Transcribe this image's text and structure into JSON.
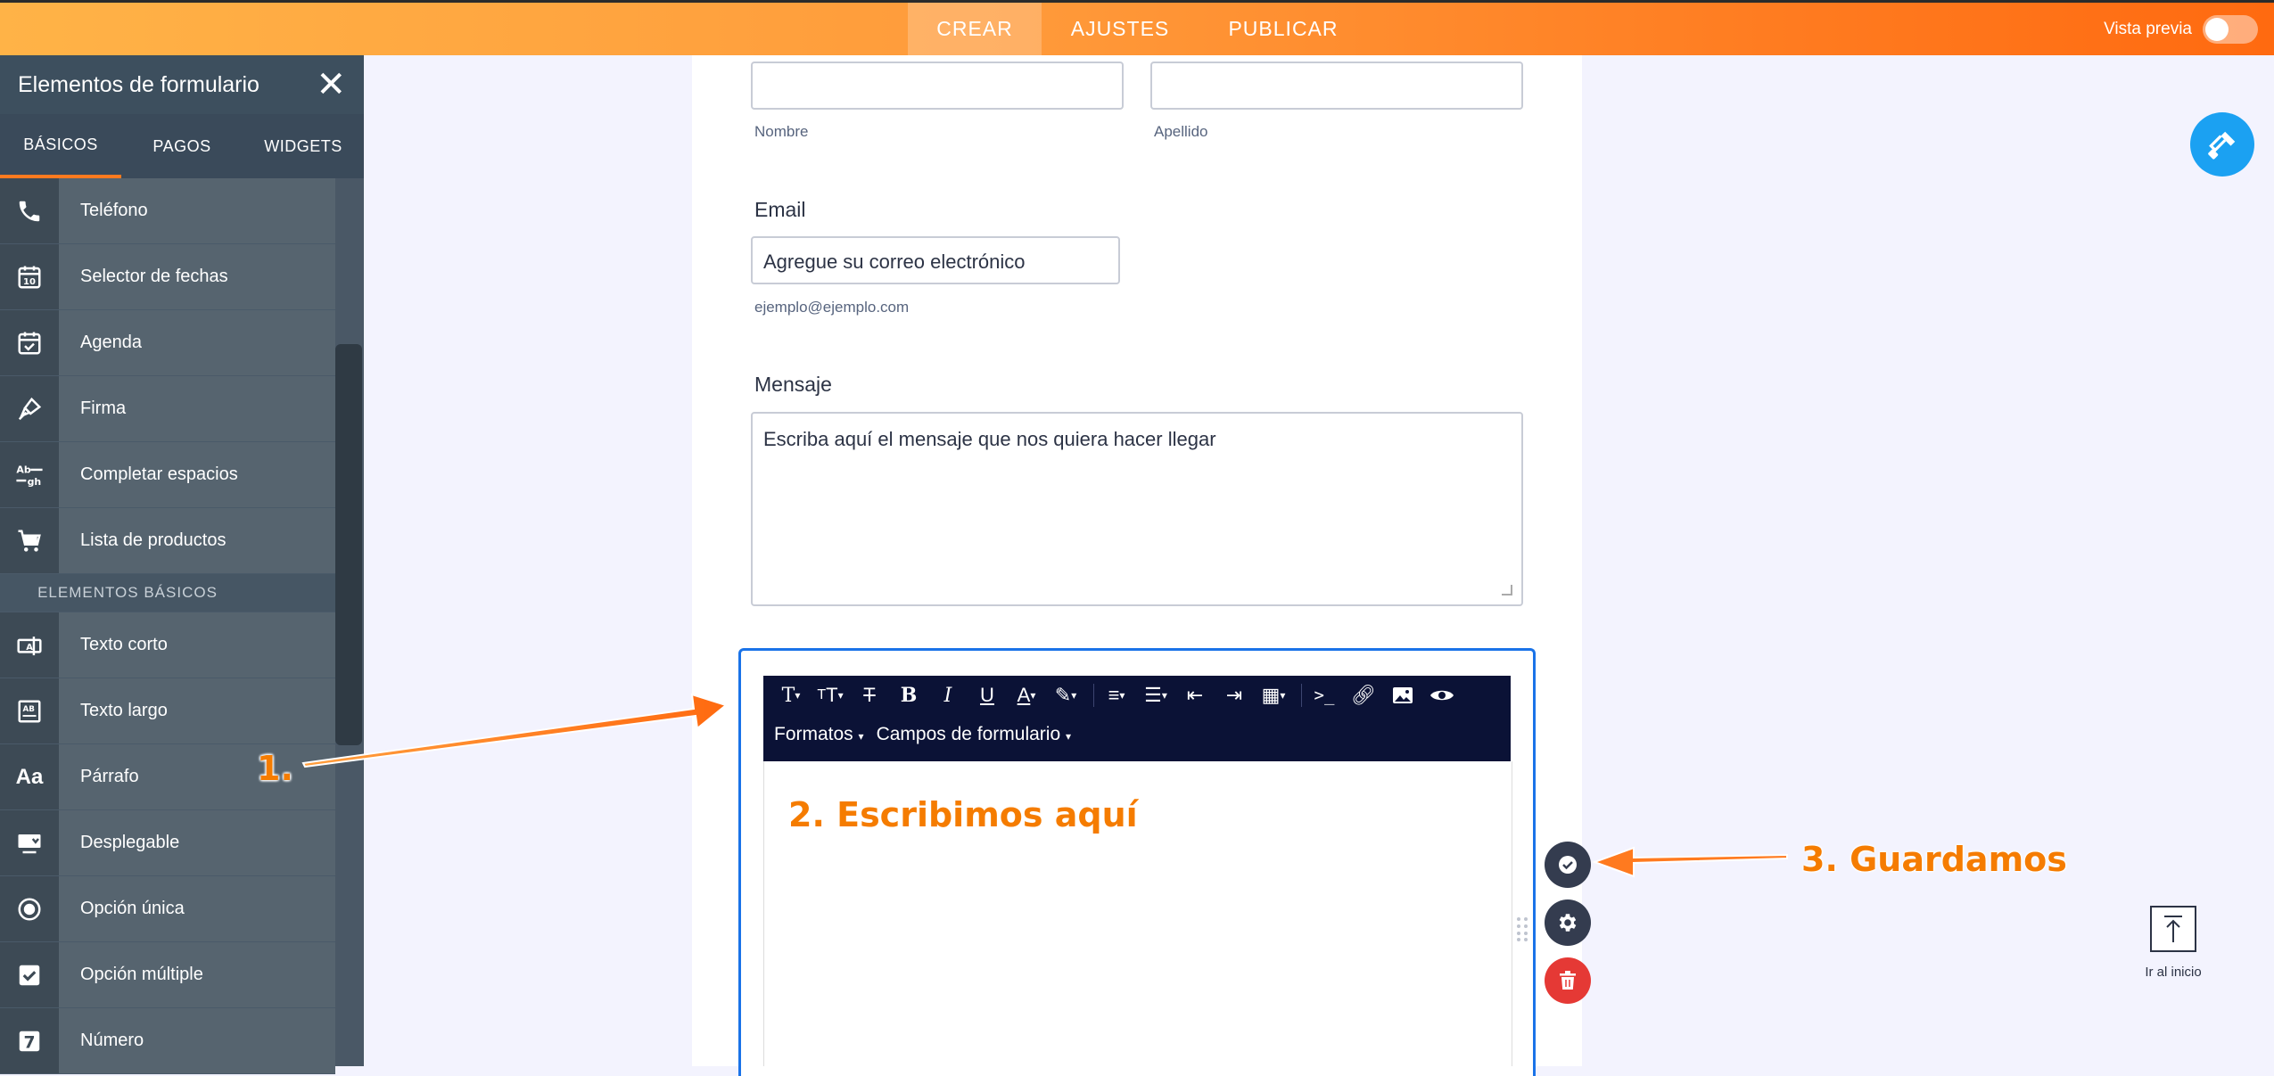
{
  "topbar": {
    "tabs": [
      "CREAR",
      "AJUSTES",
      "PUBLICAR"
    ],
    "preview_label": "Vista previa"
  },
  "sidebar": {
    "title": "Elementos de formulario",
    "tabs": [
      "BÁSICOS",
      "PAGOS",
      "WIDGETS"
    ],
    "items_top": [
      "Teléfono",
      "Selector de fechas",
      "Agenda",
      "Firma",
      "Completar espacios",
      "Lista de productos"
    ],
    "section_label": "ELEMENTOS BÁSICOS",
    "items_basic": [
      "Texto corto",
      "Texto largo",
      "Párrafo",
      "Desplegable",
      "Opción única",
      "Opción múltiple",
      "Número"
    ]
  },
  "form": {
    "name_first_sub": "Nombre",
    "name_last_sub": "Apellido",
    "email_label": "Email",
    "email_placeholder": "Agregue su correo electrónico",
    "email_sub": "ejemplo@ejemplo.com",
    "message_label": "Mensaje",
    "message_placeholder": "Escriba aquí el mensaje que nos quiera hacer llegar"
  },
  "editor": {
    "formats_label": "Formatos",
    "fields_label": "Campos de formulario"
  },
  "goto_top_label": "Ir al inicio",
  "annotations": {
    "step1": "1.",
    "step2": "2. Escribimos aquí",
    "step3": "3. Guardamos"
  },
  "colors": {
    "accent_orange": "#ff7a1f",
    "sidebar_bg": "#3a4a5a",
    "editor_toolbar": "#0b1236",
    "selection_border": "#1a73e8",
    "delete_red": "#e53935",
    "paint_blue": "#1ba1f2"
  }
}
